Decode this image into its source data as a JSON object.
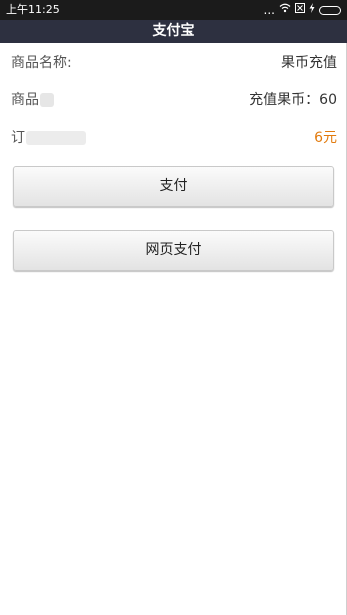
{
  "status_bar": {
    "time": "上午11:25",
    "dots": "...",
    "icons": [
      "wifi-icon",
      "sim-card-icon",
      "charging-icon",
      "battery-icon"
    ]
  },
  "title_bar": {
    "title": "支付宝"
  },
  "order": {
    "rows": [
      {
        "label": "商品名称:",
        "value": "果币充值"
      },
      {
        "label": "商品",
        "value": "充值果币：60"
      },
      {
        "label": "订",
        "value": "6元"
      }
    ]
  },
  "buttons": {
    "pay": "支付",
    "web_pay": "网页支付"
  },
  "colors": {
    "status_bar_bg": "#1b1b1b",
    "title_bar_bg": "#2d3040",
    "price_accent": "#e27b0e"
  }
}
